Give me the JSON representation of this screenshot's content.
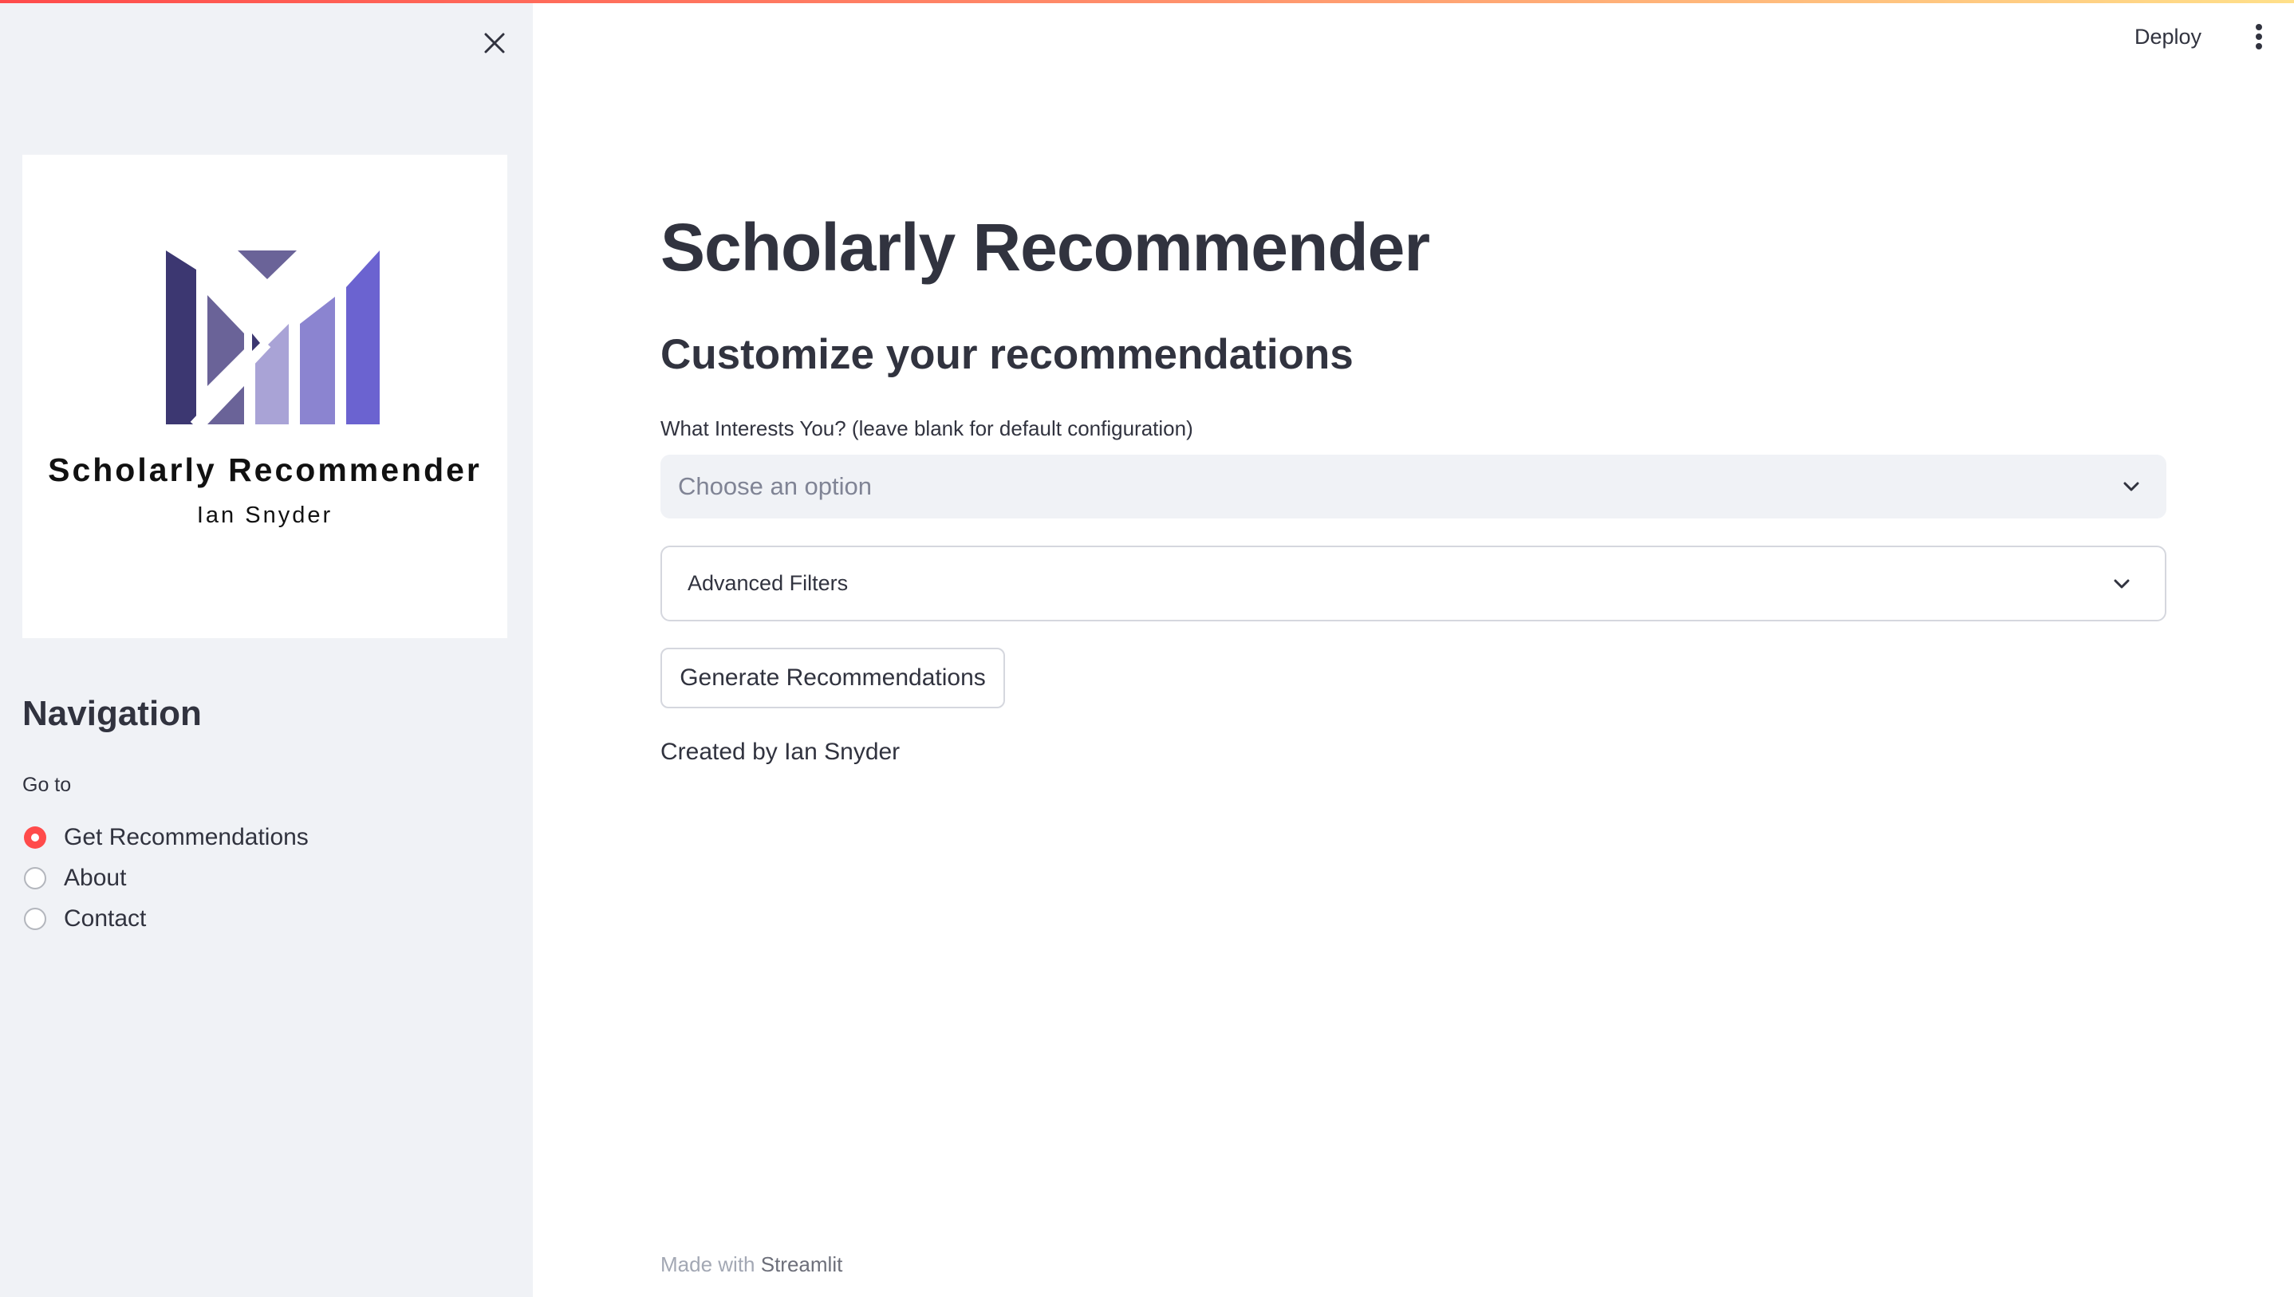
{
  "app": {
    "title": "Scholarly Recommender",
    "accent_colors": [
      "#ff4b4b",
      "#ff8f6b",
      "#ffe08a"
    ]
  },
  "header": {
    "deploy_label": "Deploy",
    "menu_icon": "kebab-menu-icon"
  },
  "sidebar": {
    "close_icon": "close-icon",
    "logo": {
      "title": "Scholarly Recommender",
      "subtitle": "Ian Snyder",
      "colors": [
        "#3c3771",
        "#6a6398",
        "#a9a3d6",
        "#8b84d0",
        "#6b63d0",
        "#7b73c4"
      ]
    },
    "nav_heading": "Navigation",
    "nav_label": "Go to",
    "nav_options": [
      {
        "label": "Get Recommendations",
        "selected": true
      },
      {
        "label": "About",
        "selected": false
      },
      {
        "label": "Contact",
        "selected": false
      }
    ],
    "selected_color": "#ff4b4b"
  },
  "main": {
    "title": "Scholarly Recommender",
    "section_heading": "Customize your recommendations",
    "interests_field": {
      "label": "What Interests You? (leave blank for default configuration)",
      "placeholder": "Choose an option"
    },
    "advanced_filters_label": "Advanced Filters",
    "generate_button_label": "Generate Recommendations",
    "credit": "Created by Ian Snyder"
  },
  "footer": {
    "prefix": "Made with",
    "link": "Streamlit"
  }
}
